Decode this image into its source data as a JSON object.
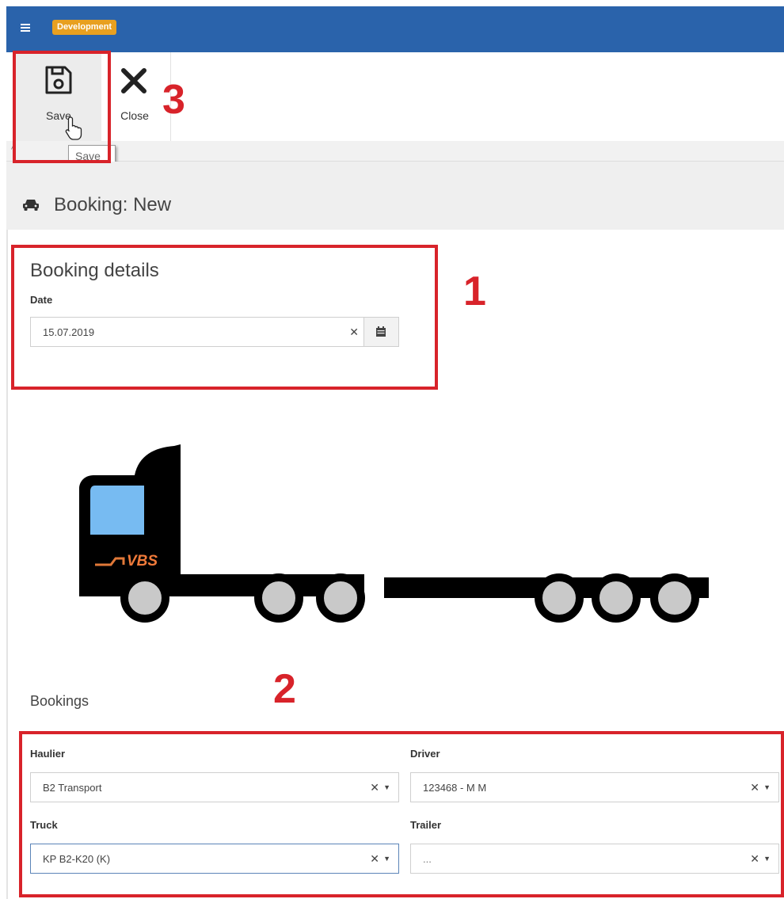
{
  "app": {
    "environment_badge": "Development",
    "menu_icon": "hamburger-icon"
  },
  "toolbar": {
    "save_label": "Save",
    "save_icon": "floppy-disk-icon",
    "close_label": "Close",
    "close_icon": "close-x-icon",
    "save_tooltip": "Save"
  },
  "page": {
    "icon": "car-icon",
    "title": "Booking: New"
  },
  "booking_details": {
    "title": "Booking details",
    "date_label": "Date",
    "date_value": "15.07.2019",
    "calendar_icon": "calendar-icon"
  },
  "illustration": {
    "logo_text": "VBS"
  },
  "bookings": {
    "title": "Bookings",
    "haulier_label": "Haulier",
    "haulier_value": "B2 Transport",
    "driver_label": "Driver",
    "driver_value": "123468 - M M",
    "truck_label": "Truck",
    "truck_value": "KP B2-K20 (K)",
    "trailer_label": "Trailer",
    "trailer_value": "..."
  },
  "annotations": {
    "one": "1",
    "two": "2",
    "three": "3"
  },
  "colors": {
    "topbar": "#2a63ab",
    "badge": "#e8a020",
    "annotation": "#d8232a"
  }
}
